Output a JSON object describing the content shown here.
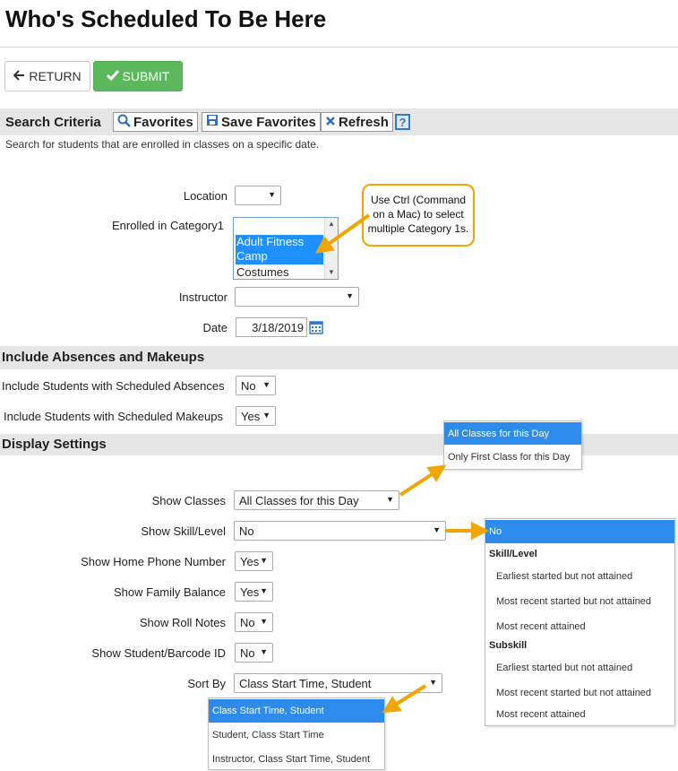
{
  "page": {
    "title": "Who's Scheduled To Be Here"
  },
  "actions": {
    "return_label": "RETURN",
    "submit_label": "SUBMIT"
  },
  "search": {
    "heading": "Search Criteria",
    "favorites_label": "Favorites",
    "save_favorites_label": "Save Favorites",
    "refresh_label": "Refresh",
    "help_glyph": "?",
    "description": "Search for students that are enrolled in classes on a specific date.",
    "location_label": "Location",
    "location_value": "",
    "category_label": "Enrolled in Category1",
    "category_options": [
      "",
      "Adult Fitness",
      "Camp",
      "Costumes"
    ],
    "callout_text": "Use Ctrl (Command on a Mac) to select multiple Category 1s.",
    "instructor_label": "Instructor",
    "instructor_value": "",
    "date_label": "Date",
    "date_value": "3/18/2019"
  },
  "absences": {
    "heading": "Include Absences and Makeups",
    "absences_label": "Include Students with Scheduled Absences",
    "absences_value": "No",
    "makeups_label": "Include Students with Scheduled Makeups",
    "makeups_value": "Yes"
  },
  "display": {
    "heading": "Display Settings",
    "show_classes_label": "Show Classes",
    "show_classes_value": "All Classes for this Day",
    "show_skill_label": "Show Skill/Level",
    "show_skill_value": "No",
    "home_phone_label": "Show Home Phone Number",
    "home_phone_value": "Yes",
    "family_balance_label": "Show Family Balance",
    "family_balance_value": "Yes",
    "roll_notes_label": "Show Roll Notes",
    "roll_notes_value": "No",
    "barcode_label": "Show Student/Barcode ID",
    "barcode_value": "No",
    "sort_label": "Sort By",
    "sort_value": "Class Start Time, Student"
  },
  "classes_dropdown": {
    "options": [
      "All Classes for this Day",
      "Only First Class for this Day"
    ]
  },
  "skill_dropdown": {
    "none": "No",
    "group1": "Skill/Level",
    "group1_items": [
      "Earliest started but not attained",
      "Most recent started but not attained",
      "Most recent attained"
    ],
    "group2": "Subskill",
    "group2_items": [
      "Earliest started but not attained",
      "Most recent started but not attained",
      "Most recent attained"
    ]
  },
  "sort_dropdown": {
    "options": [
      "Class Start Time, Student",
      "Student, Class Start Time",
      "Instructor, Class Start Time, Student"
    ]
  },
  "colors": {
    "submit": "#5cb85c",
    "highlight": "#2d8ceb",
    "callout": "#f0a500",
    "band": "#e6e6e6"
  }
}
